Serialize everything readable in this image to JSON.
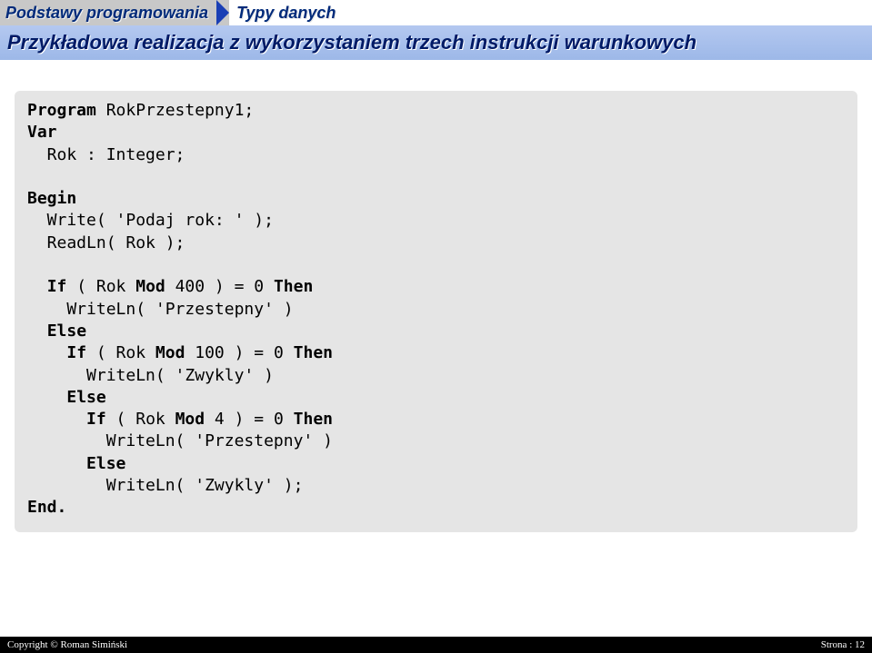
{
  "breadcrumb": {
    "left": "Podstawy programowania",
    "right": "Typy danych"
  },
  "title": "Przykładowa realizacja z wykorzystaniem trzech instrukcji warunkowych",
  "code": {
    "l1_kw": "Program",
    "l1_rest": " RokPrzestepny1;",
    "l2_kw": "Var",
    "l3": "  Rok : Integer;",
    "l5_kw": "Begin",
    "l6": "  Write( 'Podaj rok: ' );",
    "l7": "  ReadLn( Rok );",
    "l9a": "  ",
    "l9_if": "If",
    "l9b": " ( Rok ",
    "l9_mod": "Mod",
    "l9c": " 400 ) = 0 ",
    "l9_then": "Then",
    "l10": "    WriteLn( 'Przestepny' )",
    "l11a": "  ",
    "l11_else": "Else",
    "l12a": "    ",
    "l12_if": "If",
    "l12b": " ( Rok ",
    "l12_mod": "Mod",
    "l12c": " 100 ) = 0 ",
    "l12_then": "Then",
    "l13": "      WriteLn( 'Zwykly' )",
    "l14a": "    ",
    "l14_else": "Else",
    "l15a": "      ",
    "l15_if": "If",
    "l15b": " ( Rok ",
    "l15_mod": "Mod",
    "l15c": " 4 ) = 0 ",
    "l15_then": "Then",
    "l16": "        WriteLn( 'Przestepny' )",
    "l17a": "      ",
    "l17_else": "Else",
    "l18": "        WriteLn( 'Zwykly' );",
    "l19_kw": "End."
  },
  "footer": {
    "left": "Copyright © Roman Simiński",
    "right": "Strona : 12"
  }
}
